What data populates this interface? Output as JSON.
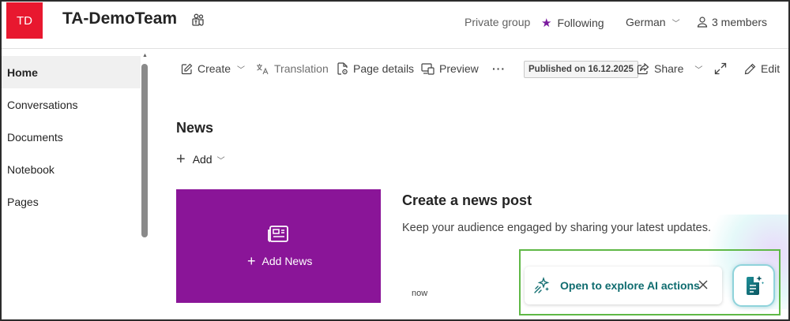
{
  "header": {
    "logo_initials": "TD",
    "site_title": "TA-DemoTeam",
    "privacy": "Private group",
    "following": "Following",
    "language": "German",
    "members": "3 members"
  },
  "sidebar": {
    "items": [
      {
        "label": "Home",
        "active": true
      },
      {
        "label": "Conversations"
      },
      {
        "label": "Documents"
      },
      {
        "label": "Notebook"
      },
      {
        "label": "Pages"
      }
    ]
  },
  "commandbar": {
    "create": "Create",
    "translation": "Translation",
    "page_details": "Page details",
    "preview": "Preview",
    "more": "···",
    "published": "Published on 16.12.2025",
    "share": "Share",
    "edit": "Edit"
  },
  "news": {
    "heading": "News",
    "add": "Add",
    "tile_label": "Add News",
    "post_title": "Create a news post",
    "post_desc": "Keep your audience engaged by sharing your latest updates.",
    "timestamp": "now"
  },
  "ai": {
    "callout_text": "Open to explore AI actions"
  },
  "colors": {
    "logo": "#e8182f",
    "tile": "#8a1598",
    "accent_purple": "#7a1a9e",
    "ai_text": "#0f6c6f",
    "highlight": "#5fb846"
  }
}
